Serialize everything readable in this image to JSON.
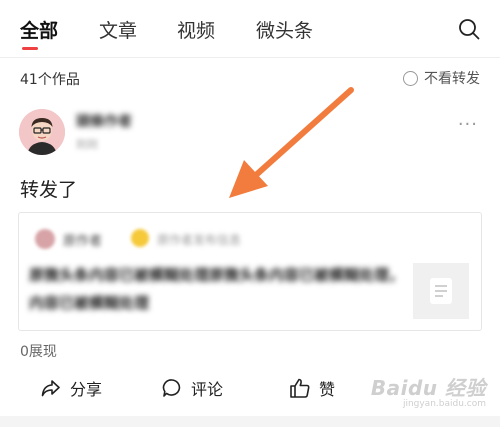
{
  "tabs": [
    {
      "label": "全部",
      "active": true
    },
    {
      "label": "文章",
      "active": false
    },
    {
      "label": "视频",
      "active": false
    },
    {
      "label": "微头条",
      "active": false
    }
  ],
  "count_label": "41个作品",
  "hide_repost_label": "不看转发",
  "author": {
    "name": "頭條作者",
    "meta": "刚刚"
  },
  "post": {
    "text": "转发了"
  },
  "quoted": {
    "name": "原作者",
    "meta": "原作者发布信息",
    "body": "原微头条内容已被模糊处理原微头条内容已被模糊处理，内容已被模糊处理"
  },
  "impressions_label": "0展现",
  "actions": {
    "share": "分享",
    "comment": "评论",
    "like": "赞"
  },
  "watermark": {
    "logo": "Baidu 经验",
    "sub": "jingyan.baidu.com"
  },
  "colors": {
    "accent": "#f04142",
    "annotation_arrow": "#f27c3e"
  }
}
